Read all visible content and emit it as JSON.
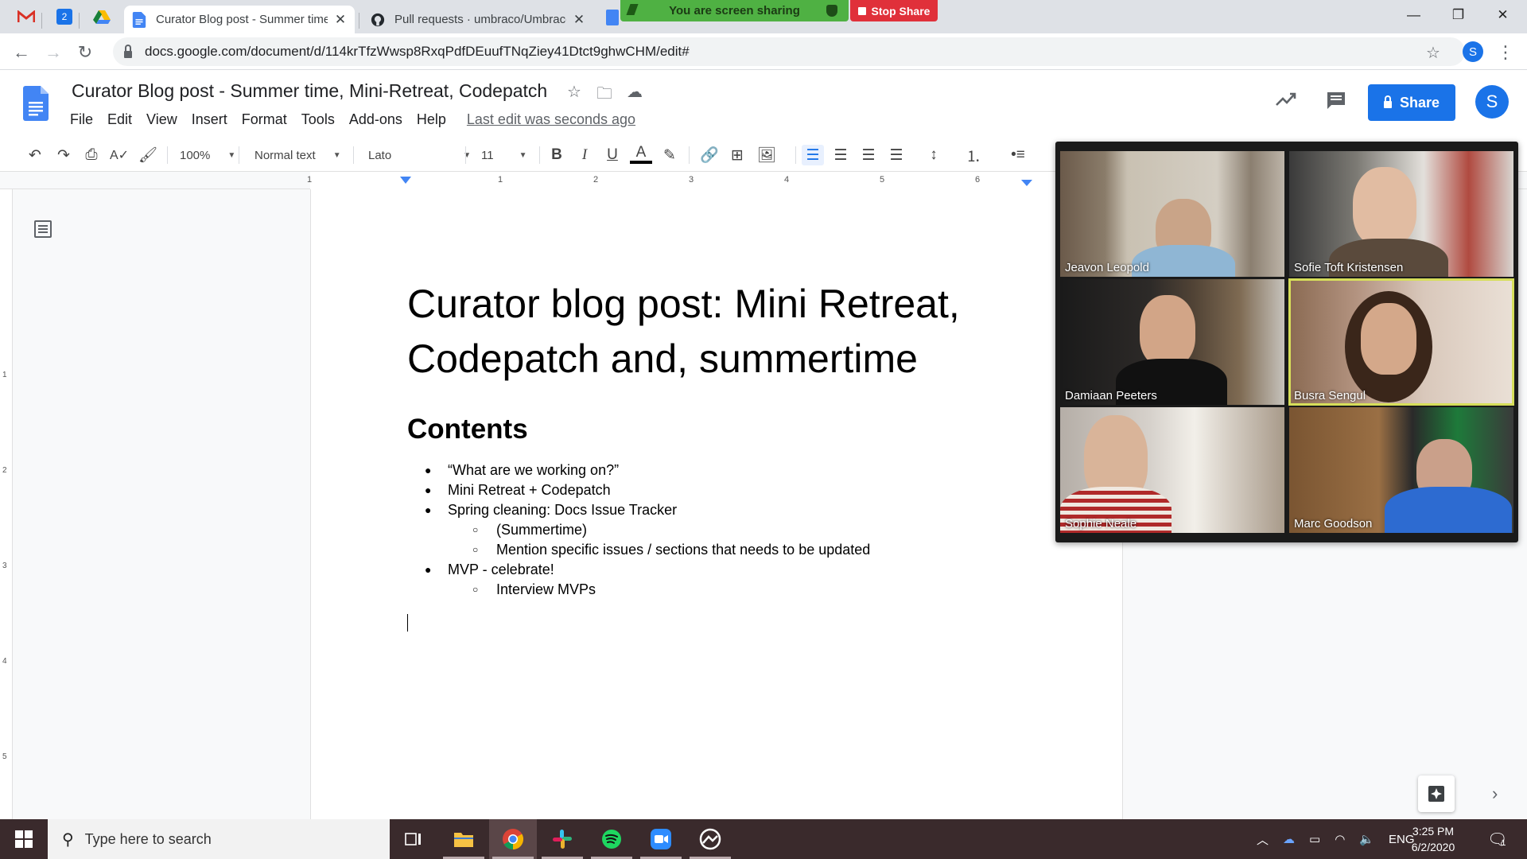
{
  "browser": {
    "tabs": [
      {
        "title": "Curator Blog post - Summer time, Mini-Retreat, Codepatch"
      },
      {
        "title": "Pull requests · umbraco/UmbracoDocs"
      }
    ],
    "calendar_badge": "2",
    "url": "docs.google.com/document/d/114krTfzWwsp8RxqPdfDEuufTNqZiey41Dtct9ghwCHM/edit#",
    "profile_initial": "S"
  },
  "zoom_share": {
    "banner": "You are screen sharing",
    "stop_label": "Stop Share"
  },
  "docs": {
    "title": "Curator Blog post - Summer time, Mini-Retreat, Codepatch",
    "menu": [
      "File",
      "Edit",
      "View",
      "Insert",
      "Format",
      "Tools",
      "Add-ons",
      "Help"
    ],
    "last_edit": "Last edit was seconds ago",
    "share_label": "Share",
    "user_initial": "S",
    "accent": "#1a73e8"
  },
  "toolbar": {
    "zoom": "100%",
    "style": "Normal text",
    "font": "Lato",
    "size": "11"
  },
  "ruler": {
    "numbers": [
      "1",
      "1",
      "2",
      "3",
      "4",
      "5",
      "6"
    ],
    "vnumbers": [
      "1",
      "2",
      "3",
      "4",
      "5"
    ]
  },
  "document": {
    "heading": "Curator blog post: Mini Retreat, Codepatch and, summertime",
    "contents_title": "Contents",
    "items": [
      {
        "level": 1,
        "text": "“What are we working on?”"
      },
      {
        "level": 1,
        "text": "Mini Retreat + Codepatch"
      },
      {
        "level": 1,
        "text": "Spring cleaning: Docs Issue Tracker"
      },
      {
        "level": 2,
        "text": "(Summertime)"
      },
      {
        "level": 2,
        "text": "Mention specific issues / sections that needs to be updated"
      },
      {
        "level": 1,
        "text": "MVP - celebrate!"
      },
      {
        "level": 2,
        "text": "Interview MVPs"
      }
    ]
  },
  "participants": [
    {
      "name": "Jeavon Leopold"
    },
    {
      "name": "Sofie Toft Kristensen"
    },
    {
      "name": "Damiaan Peeters"
    },
    {
      "name": "Busra Sengul",
      "active": true
    },
    {
      "name": "Sophie Neale"
    },
    {
      "name": "Marc Goodson"
    }
  ],
  "taskbar": {
    "search_placeholder": "Type here to search",
    "language": "ENG",
    "time": "3:25 PM",
    "date": "6/2/2020",
    "notification_count": "1"
  }
}
